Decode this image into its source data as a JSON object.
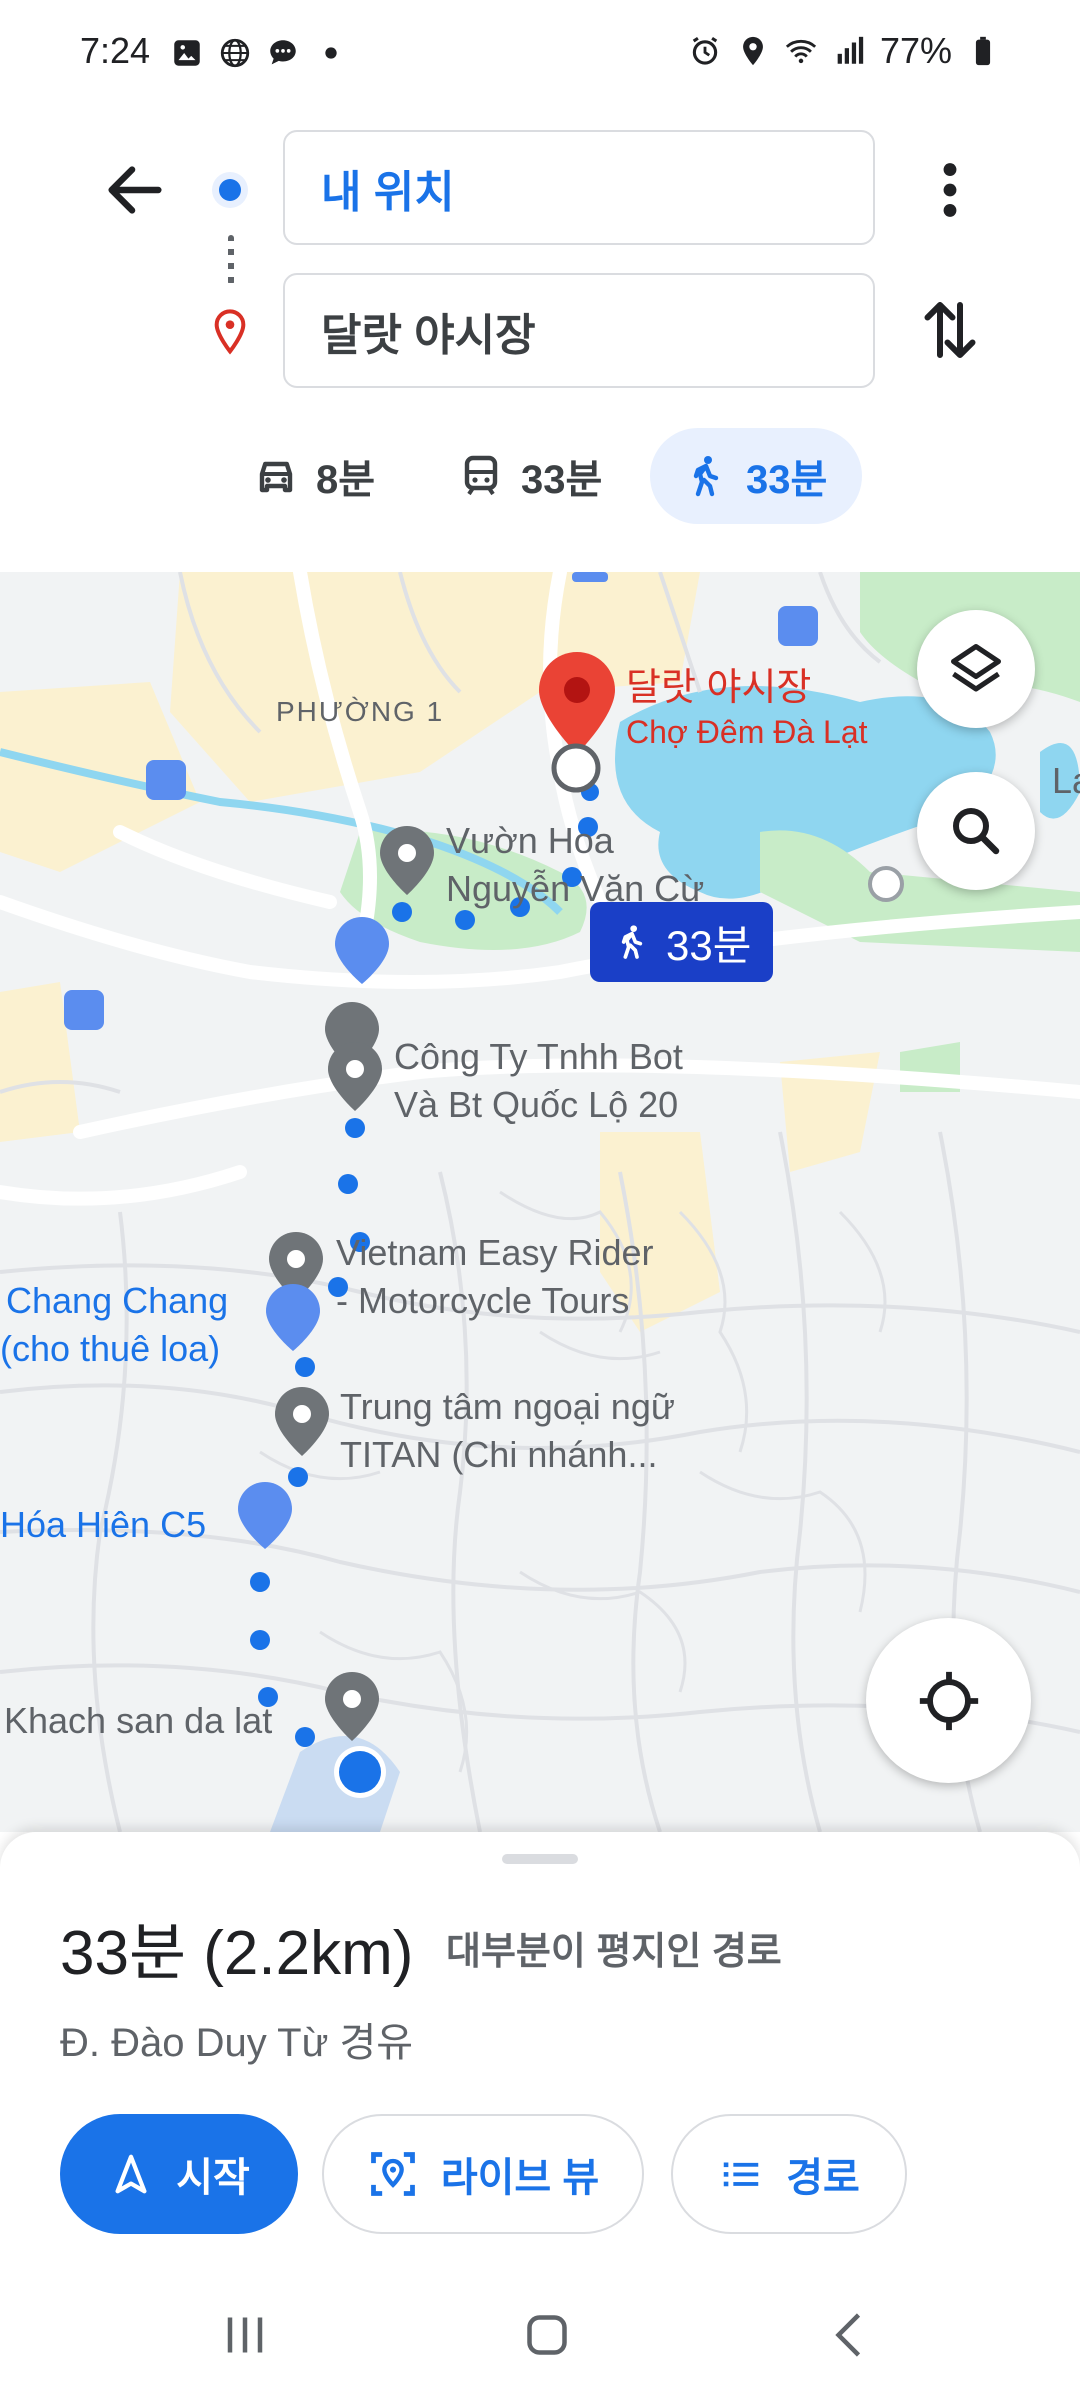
{
  "status_bar": {
    "time": "7:24",
    "battery": "77%",
    "icons": [
      "image-icon",
      "globe-icon",
      "chat-icon",
      "dot-icon",
      "alarm-icon",
      "location-icon",
      "wifi-icon",
      "signal-icon",
      "battery-icon"
    ]
  },
  "directions": {
    "origin": "내 위치",
    "destination": "달랏 야시장"
  },
  "modes": [
    {
      "icon": "car-icon",
      "label": "8분"
    },
    {
      "icon": "transit-icon",
      "label": "33분"
    },
    {
      "icon": "walk-icon",
      "label": "33분",
      "selected": true
    }
  ],
  "map": {
    "labels": {
      "ward": "PHƯỜNG 1",
      "dest_ko": "달랏 야시장",
      "dest_vi": "Chợ Đêm Đà Lạt",
      "poi1_a": "Vườn Hoa",
      "poi1_b": "Nguyễn Văn Cừ",
      "poi2_a": "Công Ty Tnhh Bot",
      "poi2_b": "Và Bt Quốc Lộ 20",
      "poi3_a": "Vietnam Easy Rider",
      "poi3_b": "- Motorcycle Tours",
      "poi4_a": "Chang Chang",
      "poi4_b": "(cho thuê loa)",
      "poi5_a": "Trung tâm ngoại ngữ",
      "poi5_b": "TITAN (Chi nhánh...",
      "poi6": "Hóa Hiên C5",
      "poi7": "Khach san da lat",
      "edge_label": "La"
    },
    "route_chip": "33분"
  },
  "sheet": {
    "duration": "33분 (2.2km)",
    "route_note": "대부분이 평지인 경로",
    "via": "Đ. Đào Duy Từ 경유",
    "start": "시작",
    "live_view": "라이브 뷰",
    "steps": "경로"
  },
  "colors": {
    "accent": "#1a73e8",
    "route_chip": "#1a3fc7",
    "pin_red": "#ea4335",
    "water": "#8fd6f0",
    "park": "#c8ecc8"
  }
}
